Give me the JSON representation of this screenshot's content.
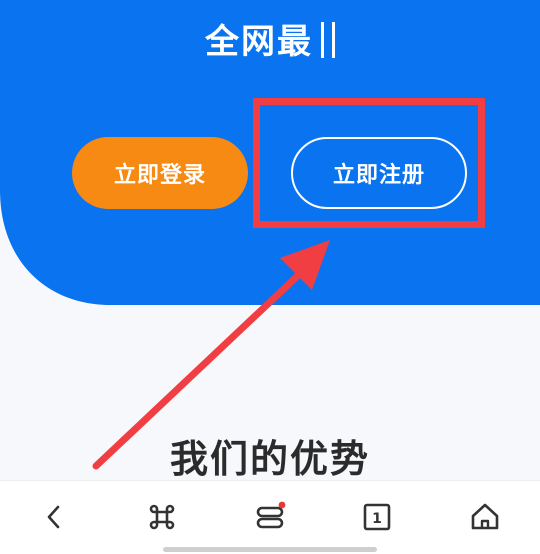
{
  "hero": {
    "title": "全网最",
    "background_color": "#0a73ef",
    "login_button": "立即登录",
    "register_button": "立即注册",
    "login_color": "#f68a12"
  },
  "annotation": {
    "color": "#f03e43"
  },
  "main": {
    "section_title": "我们的优势"
  },
  "bottom_nav": {
    "items": [
      {
        "icon": "back-chevron-icon"
      },
      {
        "icon": "command-icon"
      },
      {
        "icon": "menu-stack-icon",
        "has_notification": true
      },
      {
        "icon": "tabs-count-icon",
        "count": "1"
      },
      {
        "icon": "home-icon"
      }
    ]
  }
}
